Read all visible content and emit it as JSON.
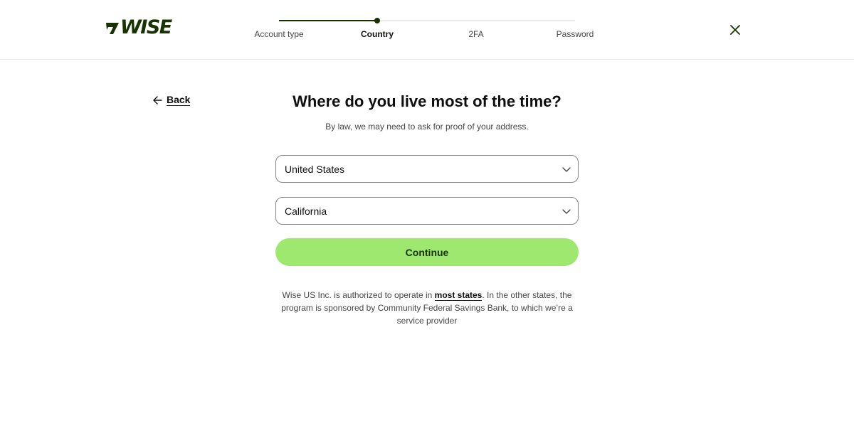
{
  "brand": {
    "logo_text": "WISE",
    "primary_color": "#163300",
    "accent_color": "#9fe870"
  },
  "stepper": {
    "steps": [
      {
        "label": "Account type",
        "active": false
      },
      {
        "label": "Country",
        "active": true
      },
      {
        "label": "2FA",
        "active": false
      },
      {
        "label": "Password",
        "active": false
      }
    ],
    "current_step": 2,
    "total_steps": 4
  },
  "header": {
    "close_icon": "close-icon"
  },
  "nav": {
    "back_label": "Back",
    "back_icon": "arrow-left-icon"
  },
  "main": {
    "title": "Where do you live most of the time?",
    "subtitle": "By law, we may need to ask for proof of your address.",
    "country_select": {
      "value": "United States",
      "icon": "chevron-down-icon"
    },
    "state_select": {
      "value": "California",
      "icon": "chevron-down-icon"
    },
    "continue_label": "Continue"
  },
  "disclaimer": {
    "before_link": "Wise US Inc. is authorized to operate in ",
    "link_text": "most states",
    "after_link": ". In the other states, the program is sponsored by Community Federal Savings Bank, to which we’re a service provider"
  }
}
